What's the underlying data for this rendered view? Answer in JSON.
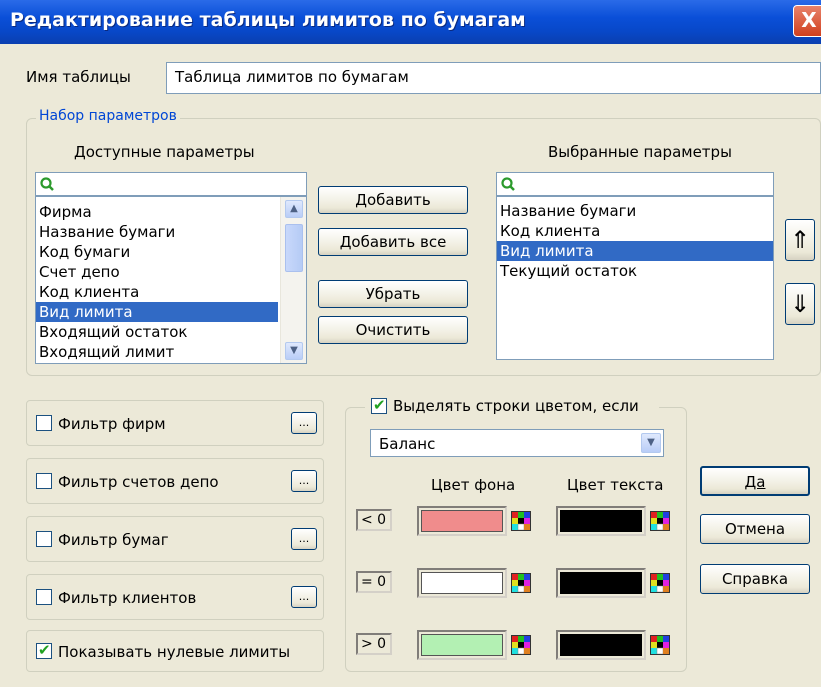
{
  "window": {
    "title": "Редактирование таблицы лимитов по бумагам",
    "close_glyph": "X"
  },
  "table_name": {
    "label": "Имя таблицы",
    "value": "Таблица лимитов по бумагам"
  },
  "params_group": {
    "legend": "Набор параметров",
    "available": {
      "header": "Доступные параметры",
      "search_value": "",
      "items": [
        "Фирма",
        "Название бумаги",
        "Код бумаги",
        "Счет депо",
        "Код клиента",
        "Вид лимита",
        "Входящий остаток",
        "Входящий лимит"
      ],
      "selected_index": 5
    },
    "buttons": {
      "add": "Добавить",
      "add_all": "Добавить все",
      "remove": "Убрать",
      "clear": "Очистить"
    },
    "chosen": {
      "header": "Выбранные параметры",
      "search_value": "",
      "items": [
        "Название бумаги",
        "Код клиента",
        "Вид лимита",
        "Текущий остаток"
      ],
      "selected_index": 2
    },
    "move_up_glyph": "⇑",
    "move_down_glyph": "⇓"
  },
  "filters": [
    {
      "label": "Фильтр фирм",
      "checked": false,
      "button": "..."
    },
    {
      "label": "Фильтр счетов депо",
      "checked": false,
      "button": "..."
    },
    {
      "label": "Фильтр бумаг",
      "checked": false,
      "button": "..."
    },
    {
      "label": "Фильтр клиентов",
      "checked": false,
      "button": "..."
    }
  ],
  "show_zero": {
    "label": "Показывать нулевые лимиты",
    "checked": true
  },
  "highlight": {
    "label": "Выделять строки цветом, если",
    "checked": true,
    "field_value": "Баланс",
    "bg_header": "Цвет фона",
    "text_header": "Цвет текста",
    "rows": [
      {
        "cond": "< 0",
        "bg": "#f08c8c",
        "text": "#000000"
      },
      {
        "cond": "= 0",
        "bg": "#ffffff",
        "text": "#000000"
      },
      {
        "cond": "> 0",
        "bg": "#b3f0b3",
        "text": "#000000"
      }
    ]
  },
  "dialog_buttons": {
    "ok": "Да",
    "cancel": "Отмена",
    "help": "Справка"
  },
  "icons": {
    "search": "search-icon",
    "palette": "palette-icon",
    "chevron": "chevron-down-icon"
  }
}
